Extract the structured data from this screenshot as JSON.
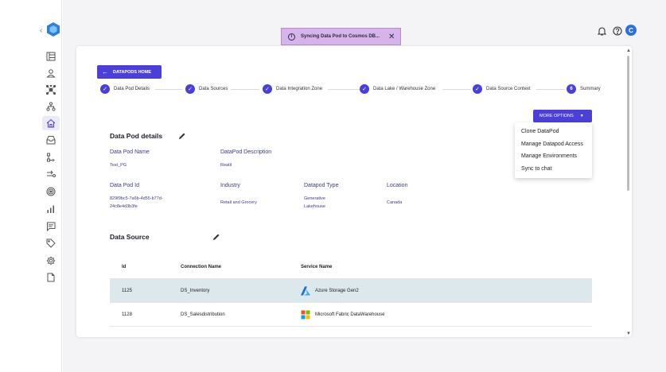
{
  "toast": {
    "message": "Syncing Data Pod to Cosmos DB...",
    "close": "✕"
  },
  "header": {
    "avatar_initial": "C",
    "icons": [
      "bell-icon",
      "help-icon"
    ]
  },
  "sidebar": {
    "collapse": "‹",
    "items": [
      "datapods-icon",
      "user-icon",
      "network-icon",
      "hierarchy-icon",
      "home-icon",
      "inbox-icon",
      "flow-icon",
      "transform-icon",
      "target-icon",
      "bar-chart-icon",
      "chat-icon",
      "tag-icon",
      "settings-icon",
      "file-icon"
    ]
  },
  "nav": {
    "home_label": "DATAPODS HOME"
  },
  "stepper": {
    "steps": [
      {
        "label": "Data Pod Details",
        "state": "done"
      },
      {
        "label": "Data Sources",
        "state": "done"
      },
      {
        "label": "Data Integration Zone",
        "state": "done"
      },
      {
        "label": "Data Lake / Warehouse Zone",
        "state": "done"
      },
      {
        "label": "Data Source Context",
        "state": "done"
      },
      {
        "label": "Summary",
        "state": "current",
        "number": "6"
      }
    ]
  },
  "more_options": {
    "label": "MORE OPTIONS",
    "items": [
      "Clone DataPod",
      "Manage Datapod Access",
      "Manage Environments",
      "Sync to chat"
    ]
  },
  "details": {
    "title": "Data Pod details",
    "name_label": "Data Pod Name",
    "name_value": "Test_PG",
    "description_label": "DataPod Description",
    "description_value": "Reatil",
    "id_label": "Data Pod Id",
    "id_value_line1": "829f9bc5-7a6b-4d55-b77d-",
    "id_value_line2": "24c8e4d3b3fe",
    "industry_label": "Industry",
    "industry_value": "Retail and Grocery",
    "type_label": "Datapod Type",
    "type_value_line1": "Generative",
    "type_value_line2": "Lakehouse",
    "location_label": "Location",
    "location_value": "Canada"
  },
  "data_source": {
    "title": "Data Source",
    "columns": [
      "Id",
      "Connection Name",
      "Service Name"
    ],
    "rows": [
      {
        "id": "1125",
        "connection": "DS_Inventory",
        "service": "Azure Storage Gen2",
        "icon": "azure-icon",
        "selected": true
      },
      {
        "id": "1128",
        "connection": "DS_Salesdistribution",
        "service": "Microsoft Fabric DataWarehouse",
        "icon": "microsoft-icon",
        "selected": false
      }
    ]
  },
  "colors": {
    "primary": "#4a3fd6",
    "toast_bg": "#d6b3e8",
    "selected_row": "#dde8ec",
    "label_text": "#3b3a8f"
  }
}
